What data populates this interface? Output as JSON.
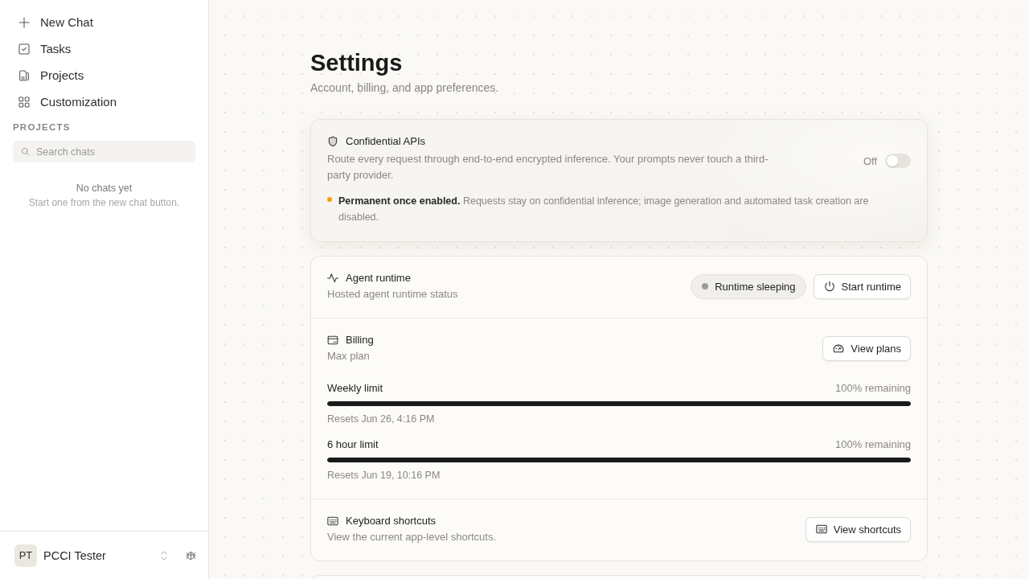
{
  "sidebar": {
    "nav_items": [
      {
        "label": "New Chat"
      },
      {
        "label": "Tasks"
      },
      {
        "label": "Projects"
      },
      {
        "label": "Customization"
      }
    ],
    "section_label": "PROJECTS",
    "search": {
      "placeholder": "Search chats"
    },
    "empty_state": {
      "title": "No chats yet",
      "hint": "Start one from the new chat button."
    },
    "user": {
      "initials": "PT",
      "name": "PCCI Tester"
    }
  },
  "header": {
    "title": "Settings",
    "subtitle": "Account, billing, and app preferences."
  },
  "confidential_apis": {
    "title": "Confidential APIs",
    "description": "Route every request through end-to-end encrypted inference. Your prompts never touch a third-party provider.",
    "toggle": {
      "label": "Off",
      "on": false
    },
    "notice": "**Permanent once enabled.** Requests stay on confidential inference; image generation and automated task creation are disabled."
  },
  "agent_runtime": {
    "title": "Agent runtime",
    "subtitle": "Hosted agent runtime status",
    "status": "Runtime sleeping",
    "button": "Start runtime"
  },
  "billing": {
    "title": "Billing",
    "subtitle": "Max plan",
    "button": "View plans",
    "limits": [
      {
        "name": "Weekly limit",
        "reading": "100% remaining",
        "level": 1,
        "reset": "Resets Jun 26, 4:16 PM"
      },
      {
        "name": "6 hour limit",
        "reading": "100% remaining",
        "level": 1,
        "reset": "Resets Jun 19, 10:16 PM"
      }
    ]
  },
  "keyboard_shortcuts": {
    "title": "Keyboard shortcuts",
    "subtitle": "View the current app-level shortcuts.",
    "button": "View shortcuts"
  }
}
